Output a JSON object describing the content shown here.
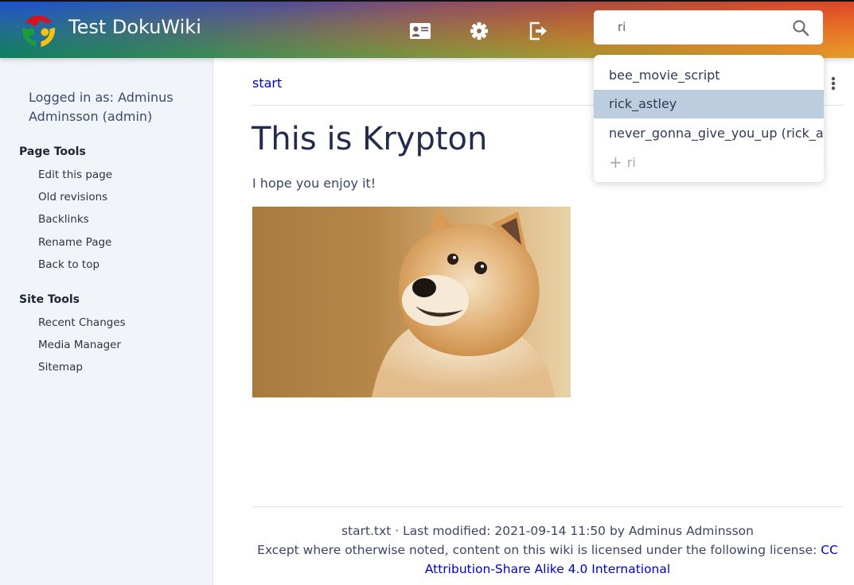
{
  "header": {
    "site_title": "Test DokuWiki",
    "icons": [
      {
        "name": "profile-card-icon",
        "label": "Update Profile"
      },
      {
        "name": "gear-icon",
        "label": "Admin"
      },
      {
        "name": "logout-icon",
        "label": "Log Out"
      }
    ],
    "search": {
      "value": "ri",
      "placeholder": "Search",
      "button_icon": "search-icon"
    }
  },
  "search_suggestions": {
    "items": [
      {
        "label": "bee_movie_script",
        "active": false
      },
      {
        "label": "rick_astley",
        "active": true
      },
      {
        "label": "never_gonna_give_you_up (rick_astley)",
        "active": false
      }
    ],
    "create_new": {
      "icon": "plus-icon",
      "label": "ri"
    }
  },
  "sidebar": {
    "user_info": "Logged in as: Adminus Adminsson (admin)",
    "page_tools": {
      "heading": "Page Tools",
      "items": [
        "Edit this page",
        "Old revisions",
        "Backlinks",
        "Rename Page",
        "Back to top"
      ]
    },
    "site_tools": {
      "heading": "Site Tools",
      "items": [
        "Recent Changes",
        "Media Manager",
        "Sitemap"
      ]
    }
  },
  "main": {
    "breadcrumb": "start",
    "more_menu_icon": "more-vertical-icon",
    "title": "This is Krypton",
    "text": "I hope you enjoy it!",
    "image_alt": "Doge (Shiba Inu) photo"
  },
  "footer": {
    "meta": "start.txt · Last modified: 2021-09-14 11:50 by Adminus Adminsson",
    "license_prefix": "Except where otherwise noted, content on this wiki is licensed under the following license:",
    "license_link": "CC Attribution-Share Alike 4.0 International"
  },
  "colors": {
    "link": "#0000cc",
    "sidebar_bg": "#f1f4f8",
    "suggestion_active_bg": "#bccddf",
    "heading": "#232b4e"
  }
}
